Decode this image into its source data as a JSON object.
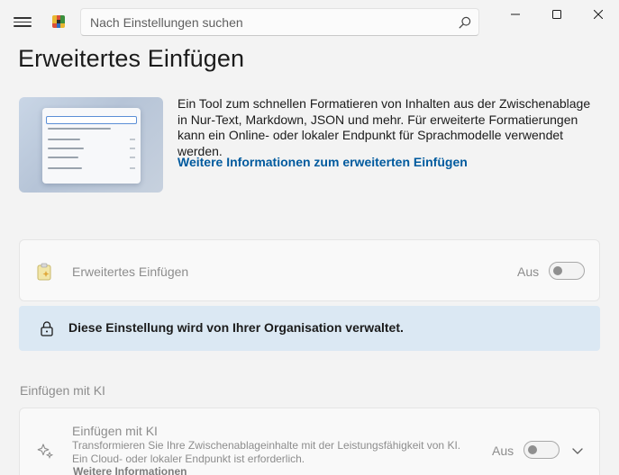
{
  "titlebar": {
    "search_placeholder": "Nach Einstellungen suchen",
    "icons": [
      "hamburger-menu-icon",
      "powertoys-logo",
      "search-icon",
      "minimize-icon",
      "maximize-icon",
      "close-icon"
    ]
  },
  "page": {
    "title": "Erweitertes Einfügen"
  },
  "hero": {
    "description": "Ein Tool zum schnellen Formatieren von Inhalten aus der Zwischenablage in Nur-Text, Markdown, JSON und mehr. Für erweiterte Formatierungen kann ein Online- oder lokaler Endpunkt für Sprachmodelle verwendet werden.",
    "link": "Weitere Informationen zum erweiterten Einfügen"
  },
  "main_setting": {
    "label": "Erweitertes Einfügen",
    "state": "Aus",
    "enabled": false
  },
  "policy_notice": {
    "text": "Diese Einstellung wird von Ihrer Organisation verwaltet."
  },
  "section_ki": {
    "heading": "Einfügen mit KI",
    "card": {
      "title": "Einfügen mit KI",
      "description": "Transformieren Sie Ihre Zwischenablageinhalte mit der Leistungsfähigkeit von KI. Ein Cloud- oder lokaler Endpunkt ist erforderlich.",
      "more_link": "Weitere Informationen",
      "state": "Aus",
      "enabled": false
    }
  },
  "colors": {
    "background": "#f3f3f3",
    "card": "#f9f9f9",
    "link": "#005a9e",
    "infobar": "#dbe8f3",
    "disabled_text": "#8d8d8d"
  }
}
